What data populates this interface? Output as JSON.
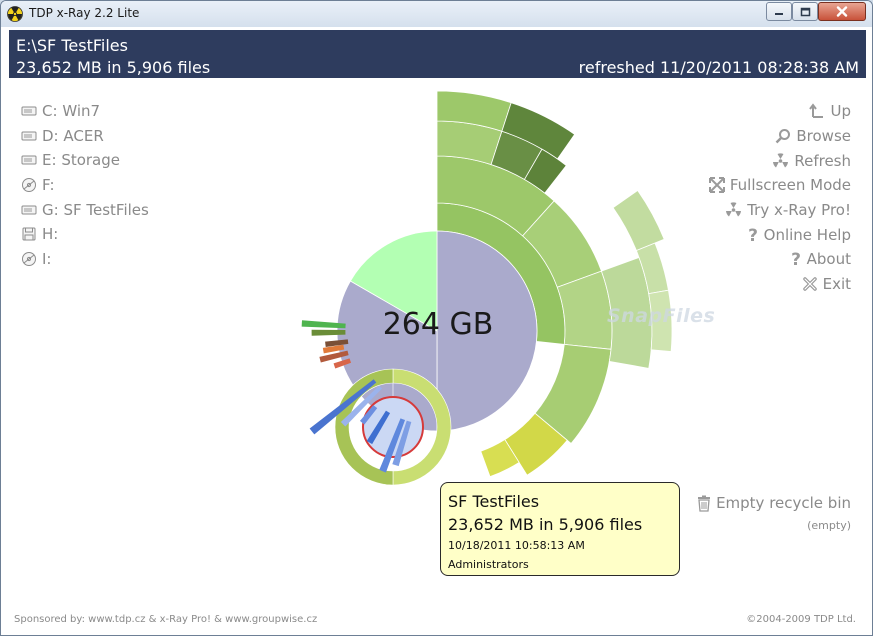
{
  "window": {
    "title": "TDP x-Ray 2.2 Lite"
  },
  "header": {
    "path": "E:\\SF TestFiles",
    "summary": "23,652 MB in 5,906 files",
    "refreshed": "refreshed 11/20/2011 08:28:38 AM"
  },
  "drives": [
    {
      "letter": "C:",
      "label": "Win7",
      "icon": "hard-drive-icon"
    },
    {
      "letter": "D:",
      "label": "ACER",
      "icon": "hard-drive-icon"
    },
    {
      "letter": "E:",
      "label": "Storage",
      "icon": "hard-drive-icon"
    },
    {
      "letter": "F:",
      "label": "",
      "icon": "optical-drive-icon"
    },
    {
      "letter": "G:",
      "label": "SF TestFiles",
      "icon": "hard-drive-icon"
    },
    {
      "letter": "H:",
      "label": "",
      "icon": "floppy-icon"
    },
    {
      "letter": "I:",
      "label": "",
      "icon": "optical-drive-icon"
    }
  ],
  "menu": {
    "up": "Up",
    "browse": "Browse",
    "refresh": "Refresh",
    "fullscreen": "Fullscreen Mode",
    "try_pro": "Try x-Ray Pro!",
    "online_help": "Online Help",
    "about": "About",
    "exit": "Exit"
  },
  "chart": {
    "center_label": "264 GB"
  },
  "watermark": "SnapFiles",
  "tooltip": {
    "name": "SF TestFiles",
    "size": "23,652 MB in 5,906 files",
    "date": "10/18/2011 10:58:13 AM",
    "owner": "Administrators"
  },
  "recycle": {
    "label": "Empty recycle bin",
    "status": "(empty)"
  },
  "footer": {
    "sponsor": "Sponsored by: www.tdp.cz & x-Ray Pro! & www.groupwise.cz",
    "copyright": "©2004-2009 TDP Ltd."
  },
  "colors": {
    "header_bg": "#2e3c5e",
    "free_space": "#b3ffb3",
    "used_space": "#aaaacc",
    "tooltip_bg": "#ffffc8"
  }
}
